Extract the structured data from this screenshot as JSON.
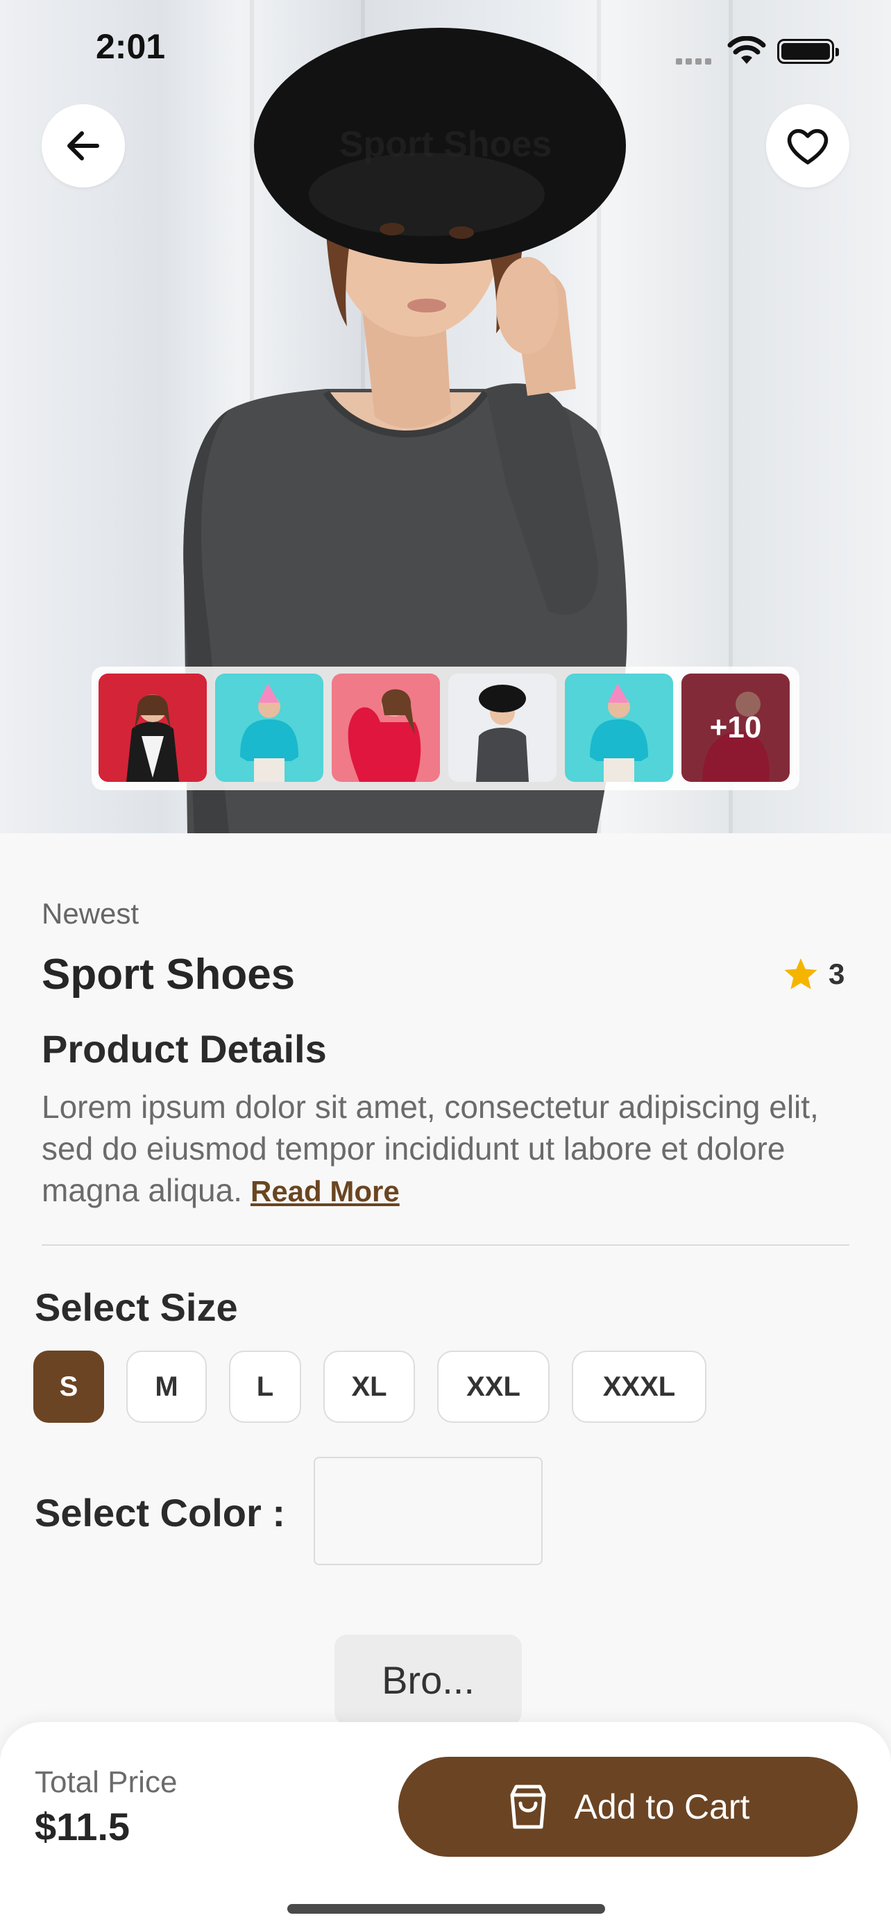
{
  "status_bar": {
    "time": "2:01"
  },
  "header": {
    "title": "Sport Shoes"
  },
  "gallery": {
    "more_count": "+10"
  },
  "product": {
    "category": "Newest",
    "name": "Sport Shoes",
    "rating": "3",
    "details_title": "Product Details",
    "description": "Lorem ipsum dolor sit amet, consectetur adipiscing elit, sed do eiusmod tempor incididunt ut labore et dolore magna aliqua.",
    "read_more": "Read More"
  },
  "size_selector": {
    "title": "Select Size",
    "options": [
      "S",
      "M",
      "L",
      "XL",
      "XXL",
      "XXXL"
    ],
    "selected": "S"
  },
  "color_selector": {
    "title": "Select Color :",
    "option_label": "Bro..."
  },
  "footer": {
    "total_label": "Total Price",
    "total_value": "$11.5",
    "add_to_cart": "Add to Cart"
  },
  "colors": {
    "accent": "#6b4423",
    "background": "#f8f8f8",
    "star": "#f5b400"
  }
}
